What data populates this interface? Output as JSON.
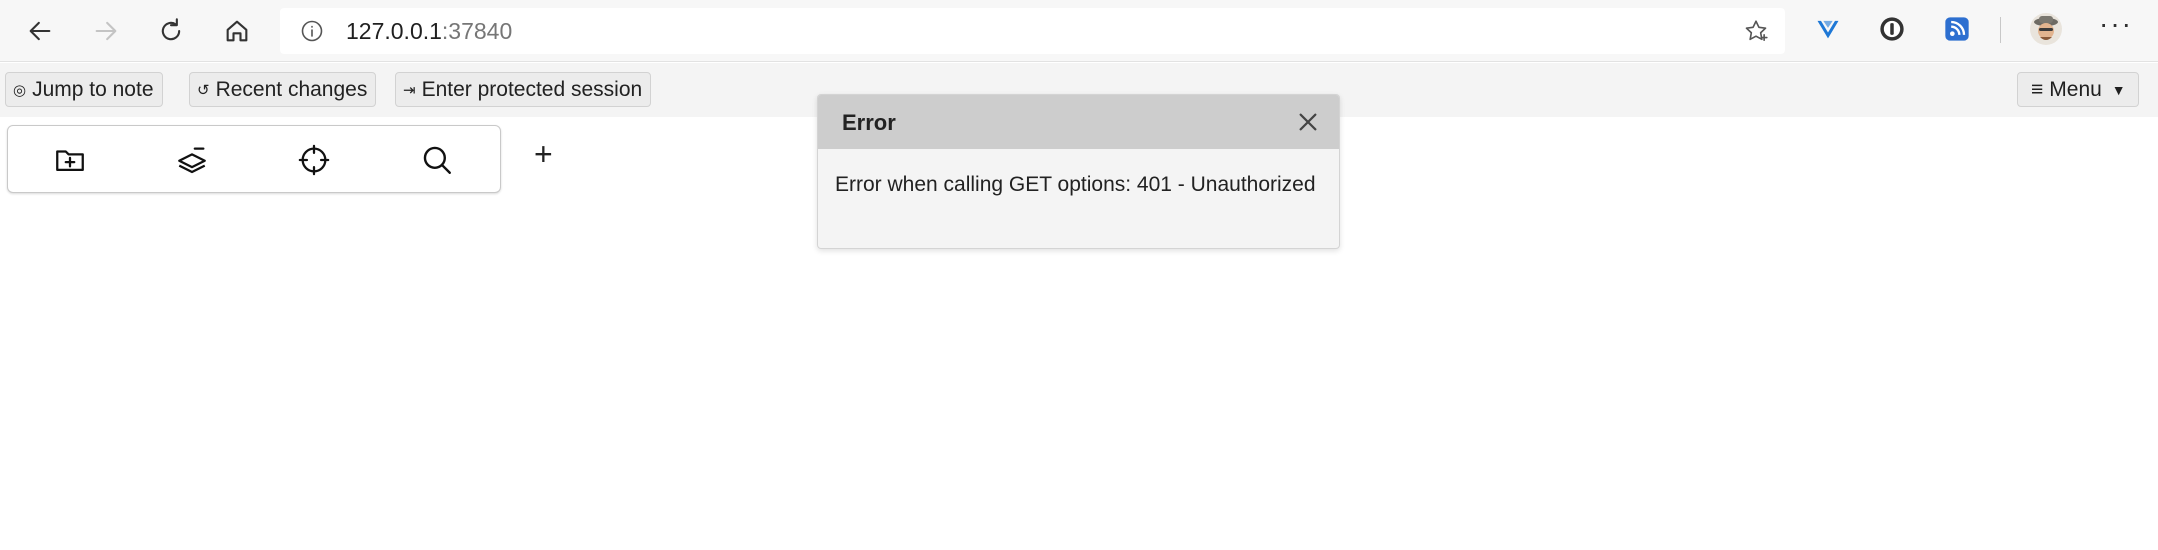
{
  "browser": {
    "url_host": "127.0.0.1",
    "url_port": ":37840",
    "icons": [
      "back-icon",
      "forward-icon",
      "refresh-icon",
      "home-icon",
      "info-icon",
      "favorite-star-icon",
      "extension-shield-icon",
      "extension-password-icon",
      "extension-feed-icon",
      "profile-avatar",
      "more-icon"
    ],
    "more_label": "···"
  },
  "toolbar": {
    "jump_to_note": "Jump to note",
    "recent_changes": "Recent changes",
    "enter_protected_session": "Enter protected session",
    "menu": "Menu"
  },
  "tree_actions": {
    "icons": [
      "create-top-level-note-icon",
      "collapse-tree-icon",
      "scroll-to-active-note-icon",
      "search-icon"
    ],
    "plus_label": "+"
  },
  "toast": {
    "title": "Error",
    "message": "Error when calling GET options: 401 - Unauthorized"
  },
  "colors": {
    "toast_header": "#cdcdcd",
    "toast_body": "#f4f4f4",
    "toolbar_bg": "#f4f4f4",
    "extension_blue": "#1e78d6"
  }
}
